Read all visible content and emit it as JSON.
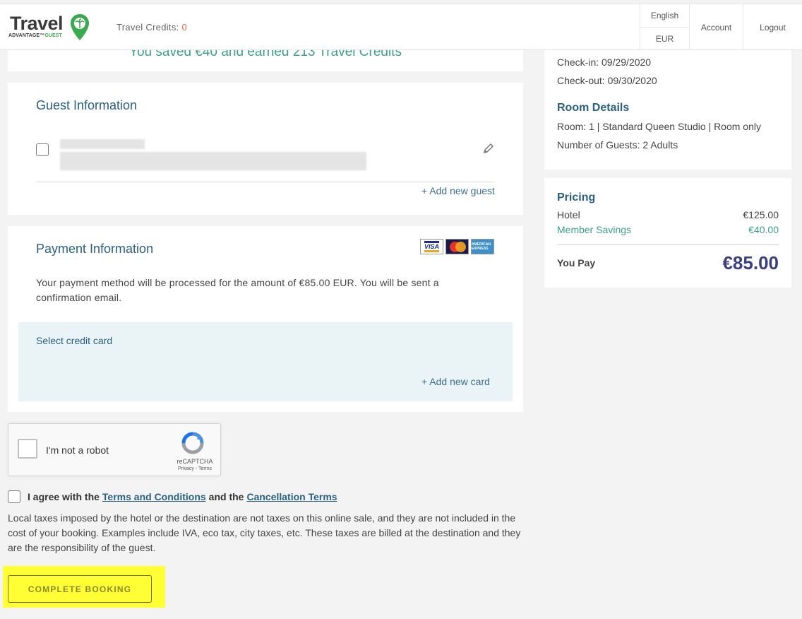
{
  "header": {
    "logo_word": "Travel",
    "logo_sub_main": "ADVANTAGE",
    "logo_sub_tm": "™",
    "logo_sub_accent": "GUEST",
    "credits_label": "Travel Credits:",
    "credits_value": "0",
    "language": "English",
    "currency": "EUR",
    "account": "Account",
    "logout": "Logout"
  },
  "banner": {
    "saved_text": "You saved €40 and earned 213 Travel Credits"
  },
  "guest": {
    "title": "Guest Information",
    "add_guest": "+ Add new guest"
  },
  "payment": {
    "title": "Payment Information",
    "card_visa": "VISA",
    "card_mc": "MasterCard",
    "card_amex": "AMERICAN EXPRESS",
    "description": "Your payment method will be processed for the amount of €85.00 EUR. You will be sent a confirmation email.",
    "select_card": "Select credit card",
    "add_card": "+ Add new card"
  },
  "captcha": {
    "label": "I'm not a robot",
    "brand": "reCAPTCHA",
    "links": "Privacy - Terms"
  },
  "agreement": {
    "prefix": "I agree with the",
    "terms": "Terms and Conditions",
    "middle": "and the",
    "cancel": "Cancellation Terms"
  },
  "taxes_note": "Local taxes imposed by the hotel or the destination are not taxes on this online sale, and they are not included in the cost of your booking. Examples include IVA, eco tax, city taxes, etc. These taxes are billed at the destination and they are the responsibility of the guest.",
  "complete_button": "COMPLETE BOOKING",
  "summary": {
    "checkin": "Check-in: 09/29/2020",
    "checkout": "Check-out: 09/30/2020",
    "room_title": "Room Details",
    "room": "Room: 1 | Standard Queen Studio | Room only",
    "guests": "Number of Guests: 2 Adults"
  },
  "pricing": {
    "title": "Pricing",
    "hotel_label": "Hotel",
    "hotel_value": "€125.00",
    "savings_label": "Member Savings",
    "savings_value": "€40.00",
    "you_pay_label": "You Pay",
    "you_pay_value": "€85.00"
  },
  "colors": {
    "accent": "#2a6080",
    "green": "#3aa08a",
    "highlight": "#ffff33",
    "total": "#3a3f80"
  }
}
